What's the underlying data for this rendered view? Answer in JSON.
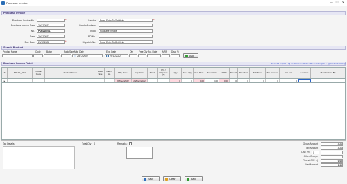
{
  "window": {
    "title": "Purchase Invoice",
    "min": "—",
    "max": "☐",
    "close": "✕"
  },
  "invoice": {
    "section_title": "Purchase Invoice",
    "fields": {
      "invoice_no": {
        "label": "Purchase Invoice No.",
        "value": ""
      },
      "invoice_date": {
        "label": "Purchase Invoice Date",
        "value": "29/12/2022"
      },
      "no": {
        "label": "No.",
        "value": "PUR2160017"
      },
      "date": {
        "label": "Date",
        "value": "29/12/2022"
      },
      "due_date": {
        "label": "Due Date",
        "value": "29/12/2022"
      },
      "vendor": {
        "label": "Vendor",
        "value": "Press Enter To Get Help"
      },
      "vendor_address": {
        "label": "Vendor Address",
        "value": ""
      },
      "book": {
        "label": "Book",
        "value": "Purchase Invoice"
      },
      "po_no": {
        "label": "PO No.",
        "value": ""
      },
      "dispatch_no": {
        "label": "Dispatch No.",
        "value": "Press Enter To Get Help"
      }
    }
  },
  "search": {
    "section_title": "Search Product",
    "labels": {
      "product_name": "Product Name",
      "code": "Code",
      "batch": "Batch",
      "pack_size": "Pack Size",
      "mfg_date": "Mfg. Date",
      "exp_date": "Exp. Date",
      "qty": "Qty",
      "free_qty": "Free Qty",
      "pur_rate": "Pur. Rate",
      "mrp": "MRP",
      "disc": "Disc. %"
    },
    "mfg_date_value": "29/12/2022",
    "exp_date_value": "29/12/2022",
    "add_label": "Add"
  },
  "detail": {
    "section_title": "Purchase Invoice Detail",
    "help_text": "Press F3 or [Ctrl + P] for Purchase Order / Press F2 or [Ctrl + Q] for Product Help",
    "columns": [
      "#",
      "PIMAS_KEY",
      "Product Code",
      "Product Name",
      "Pack Size",
      "Batch No.",
      "Mfg. Date",
      "Exp. Date",
      "Stock",
      "PO / Dispatch Qty",
      "Qty",
      "Free Qty",
      "Pur. Rate",
      "Sales Rate",
      "MRP",
      "Disc.%",
      "Disc Amt",
      "Sub Total",
      "Tax Amount",
      "Net Amt.",
      "Location",
      "Manufacture By"
    ],
    "row": {
      "mfg_date": "29/Dec/2022",
      "exp_date": "29/Dec/2022",
      "qty": "0",
      "free_qty": "0",
      "pur_rate": "0.00",
      "sales_rate": "0.00",
      "mrp": "0.00",
      "disc": "0",
      "disc_amt": "0",
      "sub_total": "0",
      "tax_amount": "0",
      "net_amt": "0"
    }
  },
  "footer": {
    "tax_details_label": "Tax Details",
    "total_qty_label": "Total Qty :",
    "total_qty_value": "0",
    "remarks_label": "Remarks :",
    "totals": {
      "gross": {
        "label": "Gross Amount :",
        "value": "0.00"
      },
      "tax": {
        "label": "Tax Amount :",
        "value": "0.00"
      },
      "disc": {
        "label": "Disc (%)",
        "value": "0"
      },
      "other": {
        "label": "Other Charge :",
        "value": ""
      },
      "round_off": {
        "label": "Round Off(+/-) :",
        "value": "0.00"
      },
      "net": {
        "label": "Net Amount :",
        "value": "0.00"
      }
    }
  },
  "buttons": {
    "save": "Save",
    "clear": "Clear",
    "back": "Back"
  },
  "colors": {
    "section_bg": "#e6e6f4",
    "required": "#d01818",
    "pink_field": "#ffd9e0",
    "help_link": "#1a3cc8"
  }
}
